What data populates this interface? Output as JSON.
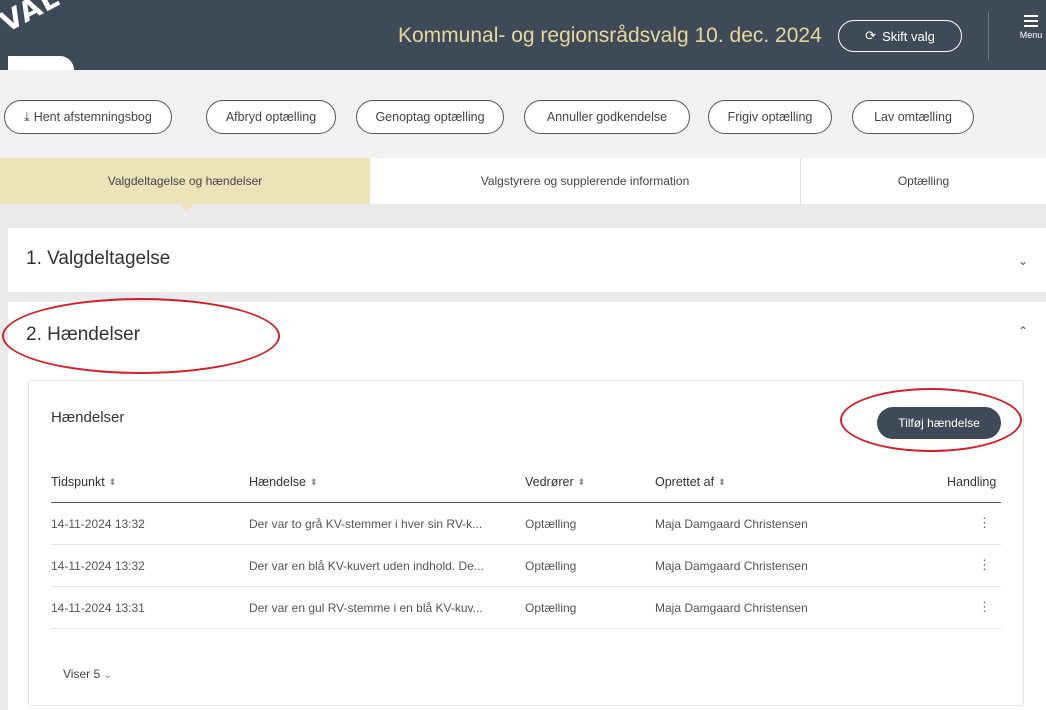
{
  "header": {
    "logo_text": "VALG",
    "title": "Kommunal- og regionsrådsvalg 10. dec. 2024",
    "skift_icon": "refresh-icon",
    "skift_label": "Skift valg",
    "menu_label": "Menu"
  },
  "actions": [
    {
      "label": "Hent afstemningsbog",
      "icon": "download-icon"
    },
    {
      "label": "Afbryd optælling"
    },
    {
      "label": "Genoptag optælling"
    },
    {
      "label": "Annuller godkendelse"
    },
    {
      "label": "Frigiv optælling"
    },
    {
      "label": "Lav omtælling"
    }
  ],
  "tabs": [
    {
      "label": "Valgdeltagelse og hændelser",
      "active": true
    },
    {
      "label": "Valgstyrere og supplerende information",
      "active": false
    },
    {
      "label": "Optælling",
      "active": false
    }
  ],
  "sections": [
    {
      "title": "1. Valgdeltagelse",
      "expanded": false
    },
    {
      "title": "2. Hændelser",
      "expanded": true
    }
  ],
  "events": {
    "title": "Hændelser",
    "add_button": "Tilføj hændelse",
    "columns": [
      "Tidspunkt",
      "Hændelse",
      "Vedrører",
      "Oprettet af",
      "Handling"
    ],
    "rows": [
      {
        "time": "14-11-2024 13:32",
        "event": "Der var to grå KV-stemmer i hver sin RV-k...",
        "concerns": "Optælling",
        "created_by": "Maja Damgaard Christensen"
      },
      {
        "time": "14-11-2024 13:32",
        "event": "Der var en blå KV-kuvert uden indhold. De...",
        "concerns": "Optælling",
        "created_by": "Maja Damgaard Christensen"
      },
      {
        "time": "14-11-2024 13:31",
        "event": "Der var en gul RV-stemme i en blå KV-kuv...",
        "concerns": "Optælling",
        "created_by": "Maja Damgaard Christensen"
      }
    ],
    "page_size_label": "Viser 5"
  },
  "colors": {
    "header_bg": "#3e4a58",
    "title_gold": "#e8d79b",
    "active_tab": "#ede2b8",
    "annotation_red": "#d0202a"
  }
}
